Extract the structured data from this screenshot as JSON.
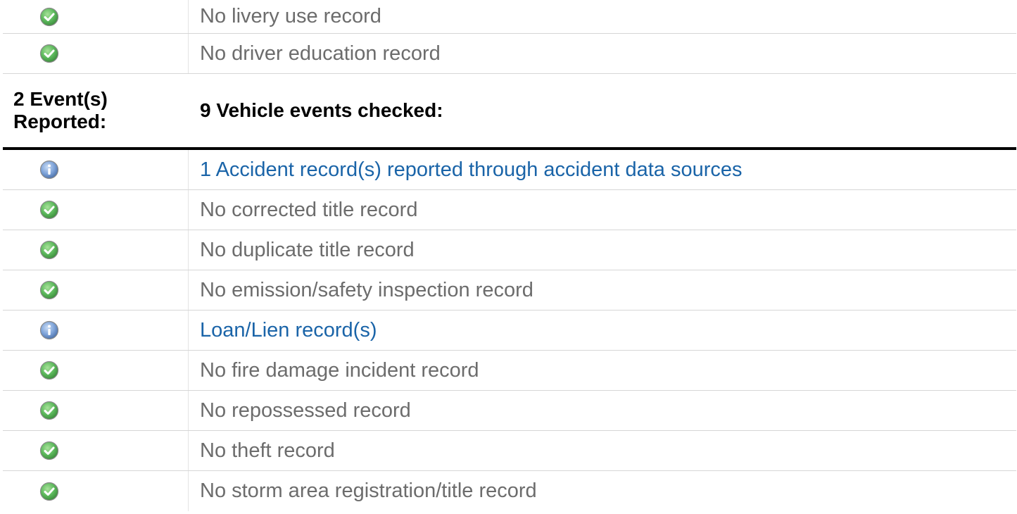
{
  "colors": {
    "ok": "#5cb85c",
    "info": "#5b86c7",
    "link": "#1a64a8",
    "muted_text": "#6c6c6c"
  },
  "top_rows": [
    {
      "icon": "check-circle-icon",
      "text": "No livery use record",
      "link": false
    },
    {
      "icon": "check-circle-icon",
      "text": "No driver education record",
      "link": false
    }
  ],
  "section": {
    "left_line1": "2 Event(s)",
    "left_line2": "Reported:",
    "title": "9 Vehicle events checked:"
  },
  "events": [
    {
      "icon": "info-circle-icon",
      "text": "1 Accident record(s) reported through accident data sources",
      "link": true
    },
    {
      "icon": "check-circle-icon",
      "text": "No corrected title record",
      "link": false
    },
    {
      "icon": "check-circle-icon",
      "text": "No duplicate title record",
      "link": false
    },
    {
      "icon": "check-circle-icon",
      "text": "No emission/safety inspection record",
      "link": false
    },
    {
      "icon": "info-circle-icon",
      "text": "Loan/Lien record(s)",
      "link": true
    },
    {
      "icon": "check-circle-icon",
      "text": "No fire damage incident record",
      "link": false
    },
    {
      "icon": "check-circle-icon",
      "text": "No repossessed record",
      "link": false
    },
    {
      "icon": "check-circle-icon",
      "text": "No theft record",
      "link": false
    },
    {
      "icon": "check-circle-icon",
      "text": "No storm area registration/title record",
      "link": false
    }
  ]
}
